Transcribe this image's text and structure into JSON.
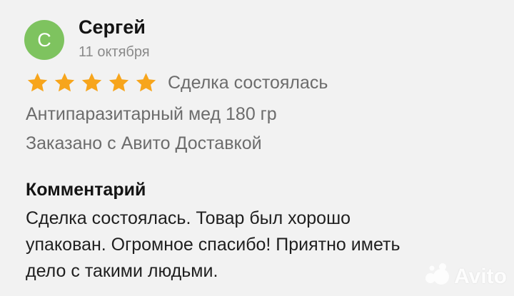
{
  "review": {
    "avatar_letter": "С",
    "author": "Сергей",
    "date": "11 октября",
    "rating": 5,
    "rating_max": 5,
    "deal_status": "Сделка состоялась",
    "product": "Антипаразитарный мед 180 гр",
    "delivery": "Заказано с Авито Доставкой",
    "comment_heading": "Комментарий",
    "comment": "Сделка состоялась. Товар был хорошо\nупакован. Огромное спасибо! Приятно иметь\nдело с такими людьми."
  },
  "watermark": {
    "text": "Avito"
  },
  "colors": {
    "avatar": "#7ec35f",
    "star": "#f7a51c",
    "background": "#f2f2f2",
    "muted_text": "#6c6c6c"
  },
  "icons": {
    "star": "star-icon",
    "watermark_logo": "avito-logo-icon"
  }
}
